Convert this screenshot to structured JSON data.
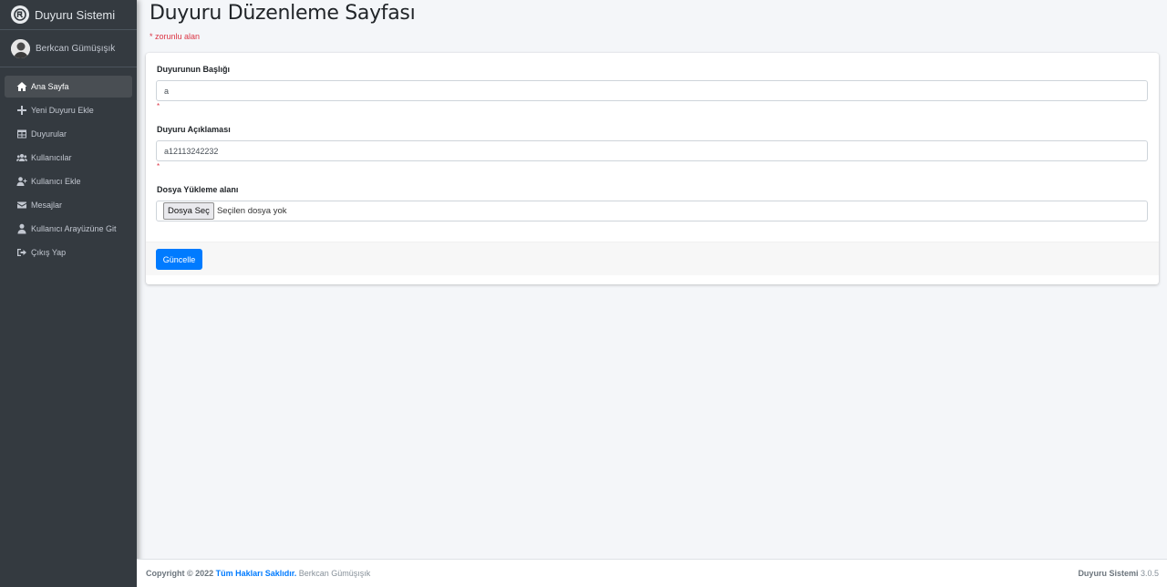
{
  "brand": {
    "title": "Duyuru Sistemi"
  },
  "user": {
    "name": "Berkcan Gümüşışık"
  },
  "sidebar": {
    "items": [
      {
        "label": "Ana Sayfa",
        "icon": "home-icon"
      },
      {
        "label": "Yeni Duyuru Ekle",
        "icon": "plus-icon"
      },
      {
        "label": "Duyurular",
        "icon": "table-icon"
      },
      {
        "label": "Kullanıcılar",
        "icon": "users-icon"
      },
      {
        "label": "Kullanıcı Ekle",
        "icon": "user-plus-icon"
      },
      {
        "label": "Mesajlar",
        "icon": "envelope-icon"
      },
      {
        "label": "Kullanıcı Arayüzüne Git",
        "icon": "user-icon"
      },
      {
        "label": "Çıkış Yap",
        "icon": "sign-out-icon"
      }
    ]
  },
  "page": {
    "title": "Duyuru Düzenleme Sayfası",
    "required_note": "* zorunlu alan"
  },
  "form": {
    "title_label": "Duyurunun Başlığı",
    "title_value": "a",
    "title_star": "*",
    "desc_label": "Duyuru Açıklaması",
    "desc_value": "a12113242232",
    "desc_star": "*",
    "file_label": "Dosya Yükleme alanı",
    "file_button": "Dosya Seç",
    "file_status": "Seçilen dosya yok",
    "submit_label": "Güncelle"
  },
  "footer": {
    "copyright": "Copyright © 2022",
    "rights": "Tüm Hakları Saklıdır.",
    "author": "Berkcan Gümüşışık",
    "app_name": "Duyuru Sistemi",
    "version": "3.0.5"
  },
  "colors": {
    "sidebar_bg": "#343a40",
    "primary": "#007bff",
    "danger": "#dc3545",
    "content_bg": "#f4f6f9"
  }
}
